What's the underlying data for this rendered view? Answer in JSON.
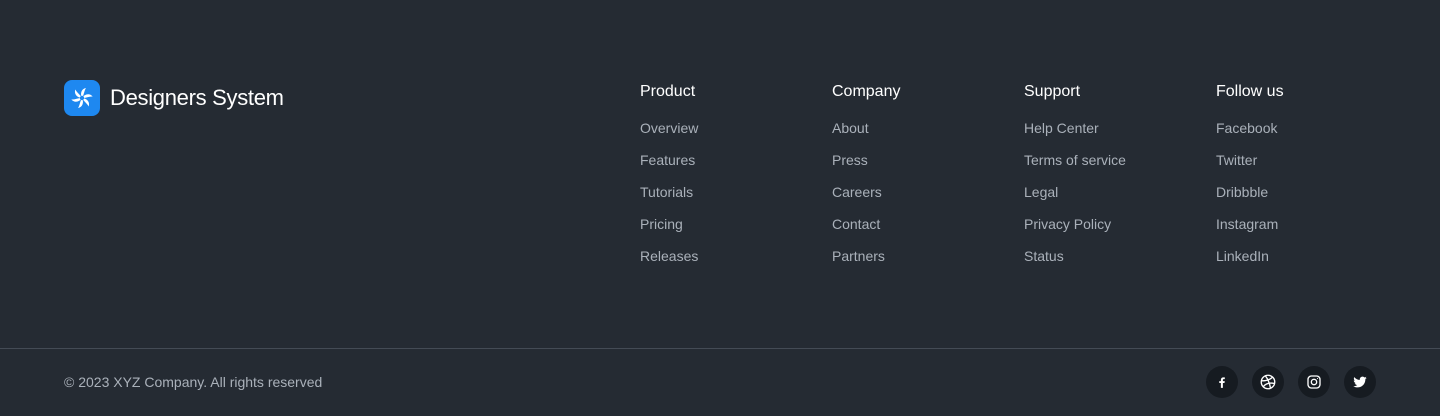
{
  "brand": {
    "name": "Designers System",
    "logo_color": "#1e88f0"
  },
  "columns": [
    {
      "title": "Product",
      "links": [
        "Overview",
        "Features",
        "Tutorials",
        "Pricing",
        "Releases"
      ]
    },
    {
      "title": "Company",
      "links": [
        "About",
        "Press",
        "Careers",
        "Contact",
        "Partners"
      ]
    },
    {
      "title": "Support",
      "links": [
        "Help Center",
        "Terms of service",
        "Legal",
        "Privacy Policy",
        "Status"
      ]
    },
    {
      "title": "Follow us",
      "links": [
        "Facebook",
        "Twitter",
        "Dribbble",
        "Instagram",
        "LinkedIn"
      ]
    }
  ],
  "bottom": {
    "copyright": "© 2023 XYZ Company. All rights reserved",
    "social_icons": [
      "facebook-icon",
      "dribbble-icon",
      "instagram-icon",
      "twitter-icon"
    ]
  },
  "colors": {
    "background": "#252b33",
    "link_text": "#aab1ba",
    "divider": "#444b55",
    "social_button_bg": "#161b21"
  }
}
